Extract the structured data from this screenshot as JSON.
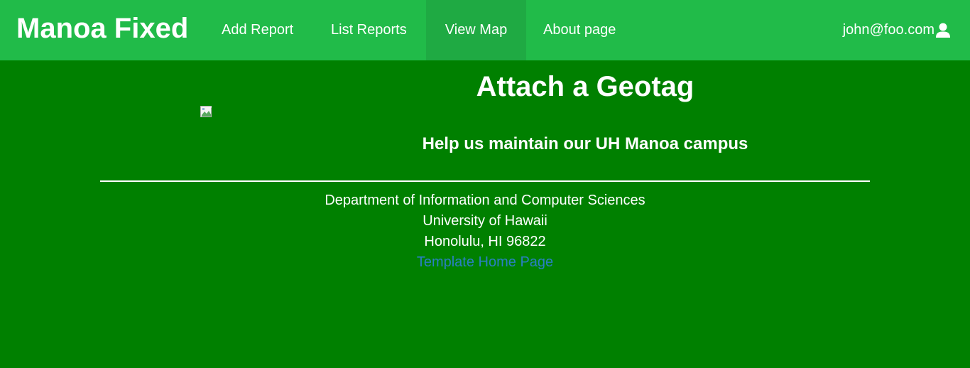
{
  "navbar": {
    "brand": "Manoa Fixed",
    "links": [
      {
        "label": "Add Report"
      },
      {
        "label": "List Reports"
      },
      {
        "label": "View Map",
        "active": true
      },
      {
        "label": "About page"
      }
    ],
    "user": {
      "email": "john@foo.com",
      "icon": "user-icon"
    }
  },
  "main": {
    "title": "Attach a Geotag",
    "subtitle": "Help us maintain our UH Manoa campus",
    "image_icon": "broken-image-icon"
  },
  "footer": {
    "line1": "Department of Information and Computer Sciences",
    "line2": "University of Hawaii",
    "line3": "Honolulu, HI 96822",
    "link": "Template Home Page"
  },
  "colors": {
    "background": "#008000",
    "navbar": "#21bb49",
    "navbar_active": "#1faa43",
    "link": "#2a7fc4"
  }
}
